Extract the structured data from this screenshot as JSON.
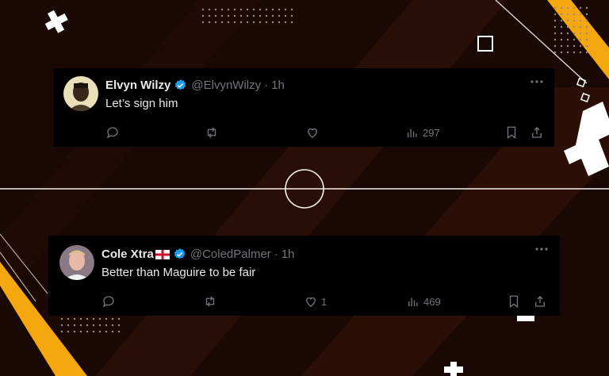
{
  "tweets": [
    {
      "name": "Elvyn Wilzy",
      "handle": "@ElvynWilzy",
      "time": "1h",
      "text": "Let’s sign him",
      "likes": "",
      "views": "297"
    },
    {
      "name": "Cole Xtra",
      "flag": "england-flag-icon",
      "handle": "@ColedPalmer",
      "time": "1h",
      "text": "Better than Maguire to be fair",
      "likes": "1",
      "views": "469"
    }
  ],
  "separator": "·",
  "colors": {
    "background": "#1c0a05",
    "card": "#000000",
    "accent_yellow": "#f5a80e",
    "verified_blue": "#1d9bf0",
    "muted": "#71767b",
    "text": "#e7e9ea"
  }
}
